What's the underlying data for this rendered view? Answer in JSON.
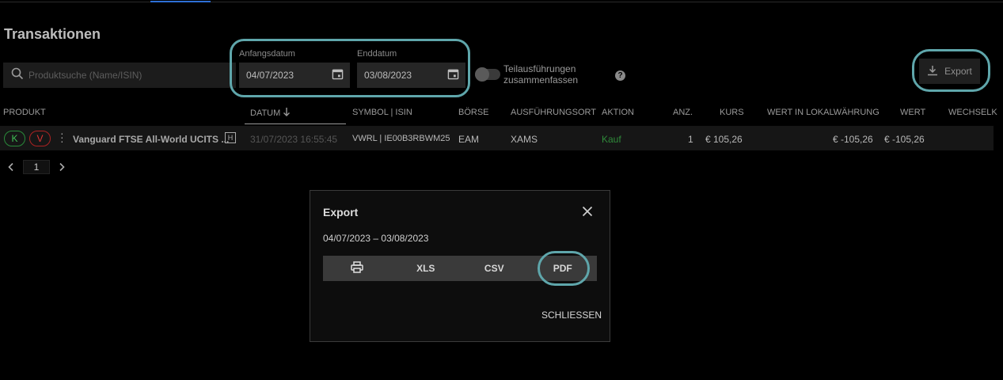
{
  "page": {
    "title": "Transaktionen"
  },
  "search": {
    "placeholder": "Produktsuche (Name/ISIN)"
  },
  "dates": {
    "start_label": "Anfangsdatum",
    "start_value": "04/07/2023",
    "end_label": "Enddatum",
    "end_value": "03/08/2023"
  },
  "toggle": {
    "label_line1": "Teilausführungen",
    "label_line2": "zusammenfassen"
  },
  "help": {
    "label": "?"
  },
  "export_button": {
    "label": "Export"
  },
  "table": {
    "headers": [
      "PRODUKT",
      "DATUM",
      "SYMBOL | ISIN",
      "BÖRSE",
      "AUSFÜHRUNGSORT",
      "AKTION",
      "ANZ.",
      "KURS",
      "WERT IN LOKALWÄHRUNG",
      "WERT",
      "WECHSELK"
    ],
    "rows": [
      {
        "k": "K",
        "v": "V",
        "product": "Vanguard FTSE All-World UCITS ...",
        "badge": "H",
        "datum": "31/07/2023 16:55:45",
        "symbol": "VWRL | IE00B3RBWM25",
        "boerse": "EAM",
        "ort": "XAMS",
        "aktion": "Kauf",
        "anz": "1",
        "kurs": "€ 105,26",
        "wert_lokal": "€ -105,26",
        "wert": "€ -105,26"
      }
    ]
  },
  "pager": {
    "page": "1"
  },
  "modal": {
    "title": "Export",
    "range": "04/07/2023 – 03/08/2023",
    "options": [
      "XLS",
      "CSV",
      "PDF"
    ],
    "close_label": "SCHLIESSEN"
  },
  "colors": {
    "accent_highlight": "#5fa6ab",
    "buy_green": "#2f8a3a",
    "sell_red": "#d33333",
    "tab_accent": "#2d6fd6"
  },
  "icons": [
    "search-icon",
    "calendar-icon",
    "download-icon",
    "arrow-down-icon",
    "more-vert-icon",
    "chevron-left-icon",
    "chevron-right-icon",
    "close-icon",
    "print-icon"
  ]
}
